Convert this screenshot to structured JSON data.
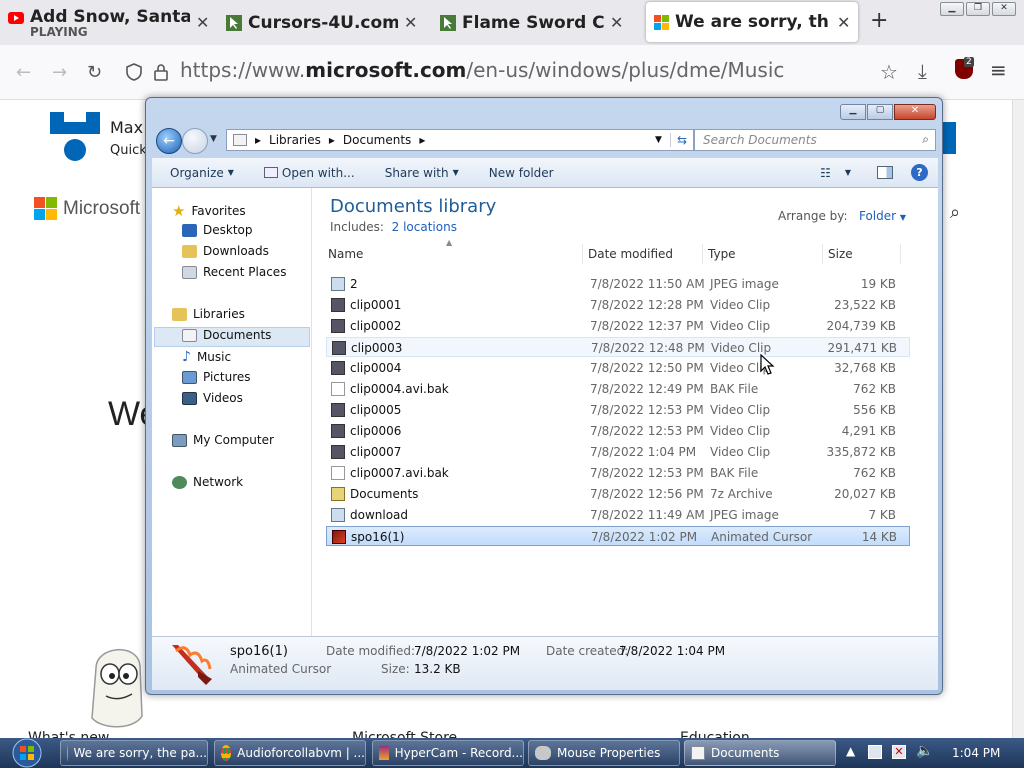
{
  "browser": {
    "tabs": [
      {
        "title": "Add Snow, Santa",
        "subtitle": "PLAYING",
        "close": "✕"
      },
      {
        "title": "Cursors-4U.com",
        "close": "✕"
      },
      {
        "title": "Flame Sword Cu",
        "close": "✕"
      },
      {
        "title": "We are sorry, th",
        "close": "✕"
      }
    ],
    "new_tab": "+",
    "url_prefix": "https://www.",
    "url_domain": "microsoft.com",
    "url_path": "/en-us/windows/plus/dme/Music",
    "ext_badge": "2"
  },
  "page": {
    "ms_brand": "Microsoft",
    "max_text": "Max",
    "quick_text": "Quick",
    "we_text": "We",
    "footer": [
      "What's new",
      "Microsoft Store",
      "Education"
    ]
  },
  "explorer": {
    "breadcrumb": [
      "Libraries",
      "Documents"
    ],
    "search_placeholder": "Search Documents",
    "toolbar": {
      "organize": "Organize",
      "open_with": "Open with...",
      "share_with": "Share with",
      "new_folder": "New folder"
    },
    "nav": {
      "favorites": "Favorites",
      "desktop": "Desktop",
      "downloads": "Downloads",
      "recent": "Recent Places",
      "libraries": "Libraries",
      "documents": "Documents",
      "music": "Music",
      "pictures": "Pictures",
      "videos": "Videos",
      "computer": "My Computer",
      "network": "Network"
    },
    "title": "Documents library",
    "includes_label": "Includes:",
    "includes_link": "2 locations",
    "arrange_label": "Arrange by:",
    "arrange_value": "Folder",
    "columns": [
      "Name",
      "Date modified",
      "Type",
      "Size"
    ],
    "files": [
      {
        "name": "2",
        "date": "7/8/2022 11:50 AM",
        "type": "JPEG image",
        "size": "19 KB"
      },
      {
        "name": "clip0001",
        "date": "7/8/2022 12:28 PM",
        "type": "Video Clip",
        "size": "23,522 KB"
      },
      {
        "name": "clip0002",
        "date": "7/8/2022 12:37 PM",
        "type": "Video Clip",
        "size": "204,739 KB"
      },
      {
        "name": "clip0003",
        "date": "7/8/2022 12:48 PM",
        "type": "Video Clip",
        "size": "291,471 KB"
      },
      {
        "name": "clip0004",
        "date": "7/8/2022 12:50 PM",
        "type": "Video Clip",
        "size": "32,768 KB"
      },
      {
        "name": "clip0004.avi.bak",
        "date": "7/8/2022 12:49 PM",
        "type": "BAK File",
        "size": "762 KB"
      },
      {
        "name": "clip0005",
        "date": "7/8/2022 12:53 PM",
        "type": "Video Clip",
        "size": "556 KB"
      },
      {
        "name": "clip0006",
        "date": "7/8/2022 12:53 PM",
        "type": "Video Clip",
        "size": "4,291 KB"
      },
      {
        "name": "clip0007",
        "date": "7/8/2022 1:04 PM",
        "type": "Video Clip",
        "size": "335,872 KB"
      },
      {
        "name": "clip0007.avi.bak",
        "date": "7/8/2022 12:53 PM",
        "type": "BAK File",
        "size": "762 KB"
      },
      {
        "name": "Documents",
        "date": "7/8/2022 12:56 PM",
        "type": "7z Archive",
        "size": "20,027 KB"
      },
      {
        "name": "download",
        "date": "7/8/2022 11:49 AM",
        "type": "JPEG image",
        "size": "7 KB"
      },
      {
        "name": "spo16(1)",
        "date": "7/8/2022 1:02 PM",
        "type": "Animated Cursor",
        "size": "14 KB"
      }
    ],
    "details": {
      "name": "spo16(1)",
      "type": "Animated Cursor",
      "modified_label": "Date modified:",
      "modified_value": "7/8/2022 1:02 PM",
      "created_label": "Date created:",
      "created_value": "7/8/2022 1:04 PM",
      "size_label": "Size:",
      "size_value": "13.2 KB"
    }
  },
  "taskbar": {
    "items": [
      "We are sorry, the pa...",
      "Audioforcollabvm | ...",
      "HyperCam - Record...",
      "Mouse Properties",
      "Documents"
    ],
    "clock": "1:04 PM"
  }
}
